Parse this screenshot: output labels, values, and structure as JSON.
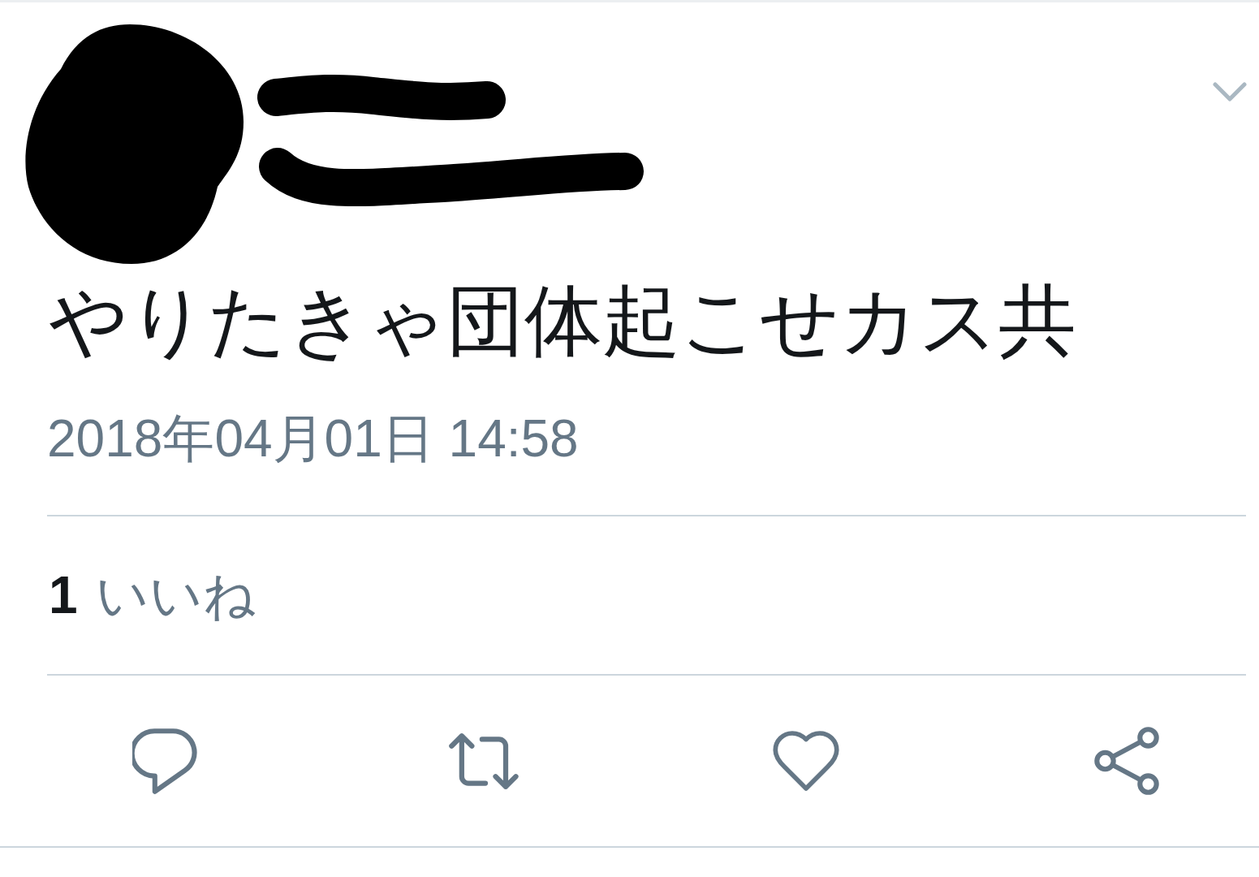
{
  "tweet": {
    "text": "やりたきゃ団体起こせカス共",
    "timestamp": "2018年04月01日 14:58",
    "likes": {
      "count": "1",
      "label": "いいね"
    },
    "actions": [
      {
        "kind": "reply"
      },
      {
        "kind": "retweet"
      },
      {
        "kind": "like"
      },
      {
        "kind": "share"
      }
    ]
  }
}
